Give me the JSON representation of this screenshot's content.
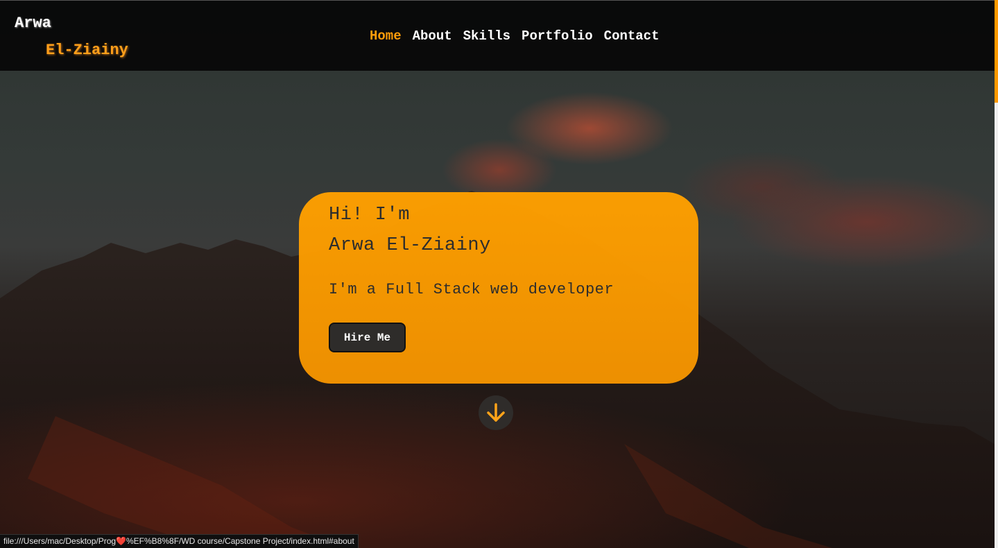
{
  "logo": {
    "first": "Arwa",
    "last": "El-Ziainy"
  },
  "nav": {
    "items": [
      {
        "label": "Home",
        "active": true
      },
      {
        "label": "About",
        "active": false
      },
      {
        "label": "Skills",
        "active": false
      },
      {
        "label": "Portfolio",
        "active": false
      },
      {
        "label": "Contact",
        "active": false
      }
    ]
  },
  "hero": {
    "greeting": "Hi! I'm",
    "name": "Arwa El-Ziainy",
    "tagline": "I'm a Full Stack web developer",
    "cta_label": "Hire Me",
    "scroll_icon": "arrow-down-icon"
  },
  "status_bar": {
    "url": "file:///Users/mac/Desktop/Prog❤️%EF%B8%8F/WD course/Capstone Project/index.html#about"
  },
  "colors": {
    "accent": "#ff9d0a",
    "card": "#f79a00",
    "dark": "#2d2d2d"
  }
}
